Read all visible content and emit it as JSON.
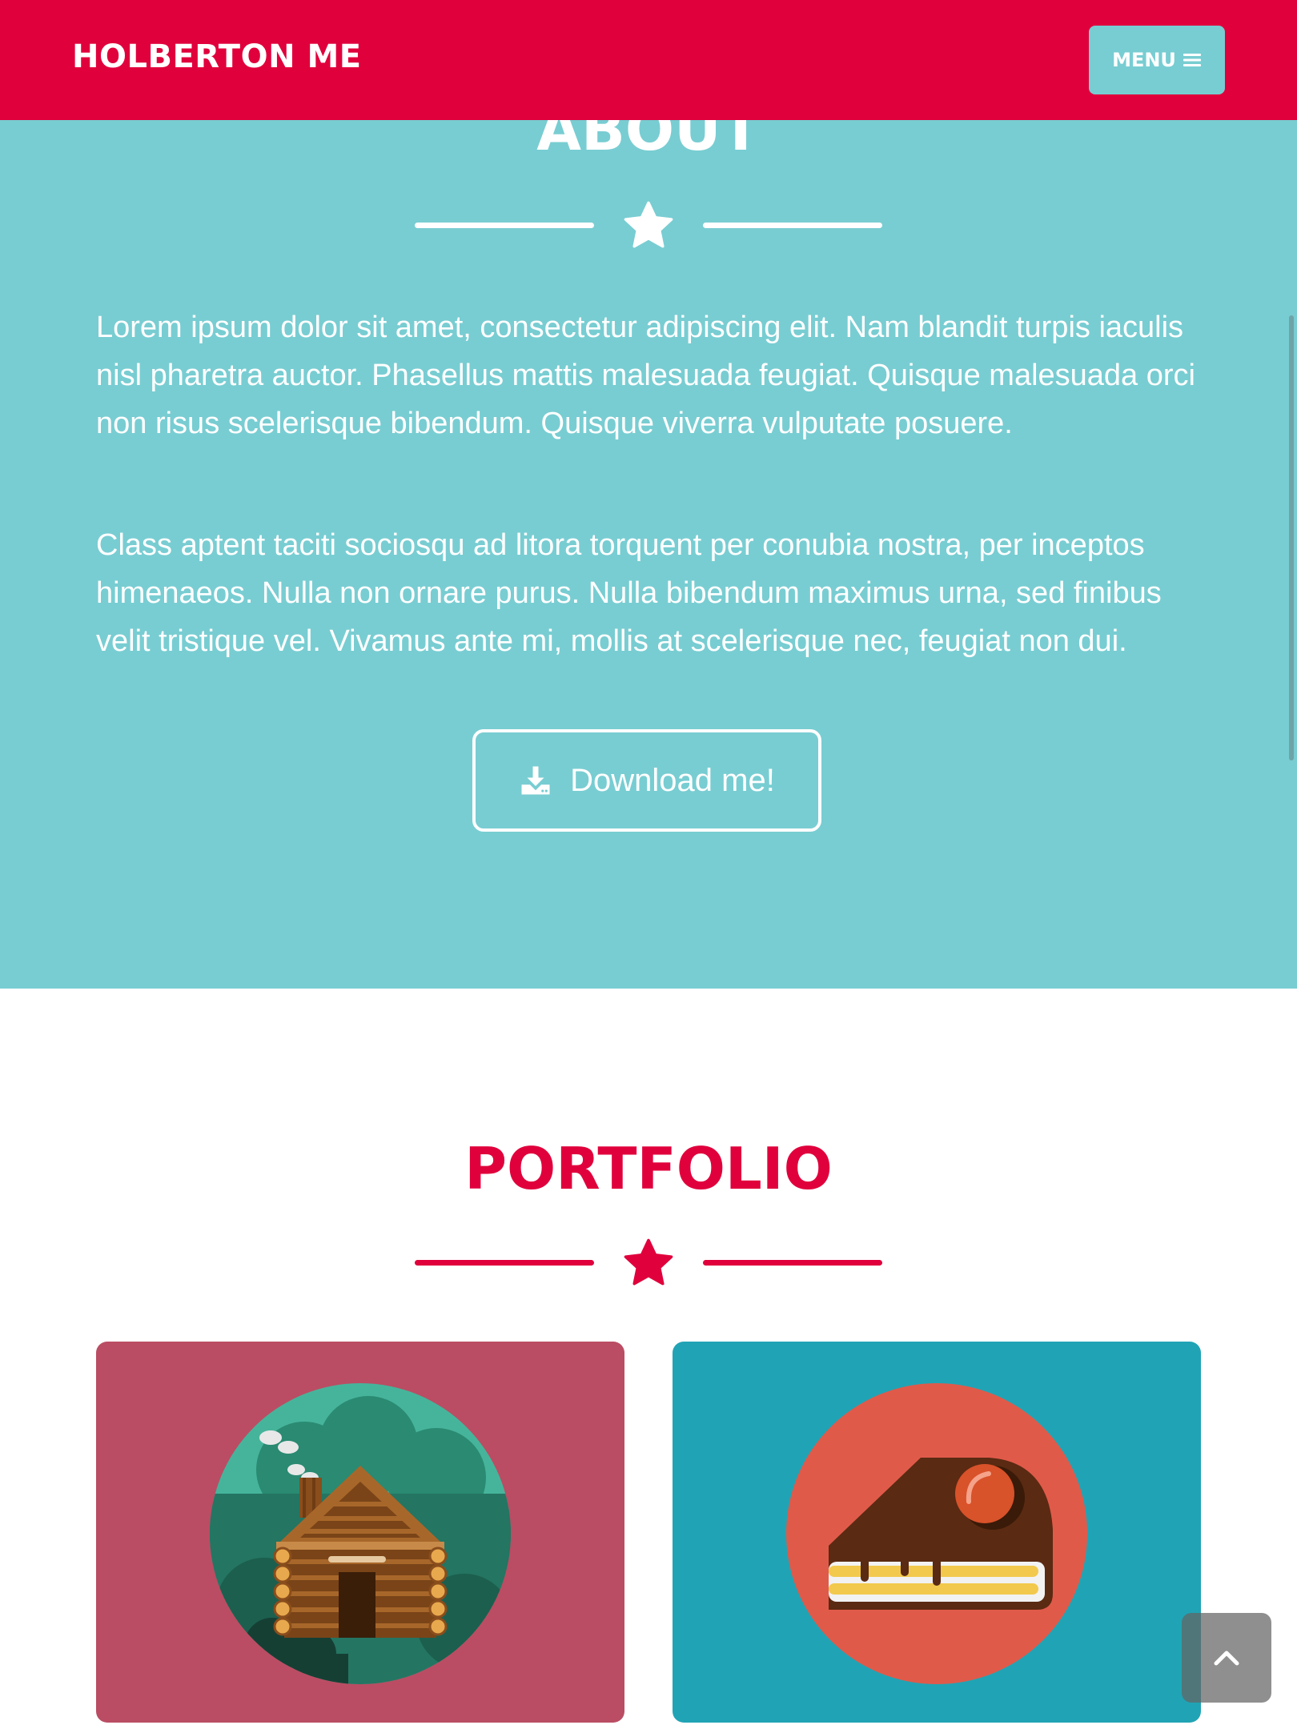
{
  "colors": {
    "primary": "#e0003c",
    "about_bg": "#78cdd2",
    "menu_bg": "#78cdd2",
    "card_cabin_bg": "#ba4d63",
    "card_cake_bg": "#20a4b5"
  },
  "navbar": {
    "brand": "HOLBERTON ME",
    "menu_label": "MENU",
    "menu_icon": "bars-icon"
  },
  "about": {
    "title": "ABOUT",
    "divider_icon": "star-icon",
    "paragraphs": [
      "Lorem ipsum dolor sit amet, consectetur adipiscing elit. Nam blandit turpis iaculis nisl pharetra auctor. Phasellus mattis malesuada feugiat. Quisque malesuada orci non risus scelerisque bibendum. Quisque viverra vulputate posuere.",
      "Class aptent taciti sociosqu ad litora torquent per conubia nostra, per inceptos himenaeos. Nulla non ornare purus. Nulla bibendum maximus urna, sed finibus velit tristique vel. Vivamus ante mi, mollis at scelerisque nec, feugiat non dui."
    ],
    "download_label": "Download me!",
    "download_icon": "download-icon"
  },
  "portfolio": {
    "title": "PORTFOLIO",
    "divider_icon": "star-icon",
    "items": [
      {
        "illustration": "cabin-illustration"
      },
      {
        "illustration": "cake-illustration"
      }
    ]
  },
  "scroll_top": {
    "icon": "chevron-up-icon"
  }
}
